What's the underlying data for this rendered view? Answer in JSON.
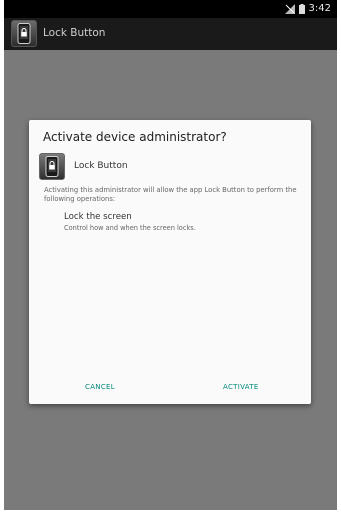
{
  "status_bar": {
    "time": "3:42"
  },
  "action_bar": {
    "title": "Lock Button",
    "icon": "lock-phone-icon"
  },
  "dialog": {
    "title": "Activate device administrator?",
    "admin_name": "Lock Button",
    "admin_icon": "lock-phone-icon",
    "description": "Activating this administrator will allow the app Lock Button to perform the following operations:",
    "permissions": [
      {
        "title": "Lock the screen",
        "description": "Control how and when the screen locks."
      }
    ],
    "buttons": {
      "cancel": "CANCEL",
      "activate": "ACTIVATE"
    }
  },
  "colors": {
    "accent": "#00897b",
    "dim_background": "#6e6e6e"
  }
}
